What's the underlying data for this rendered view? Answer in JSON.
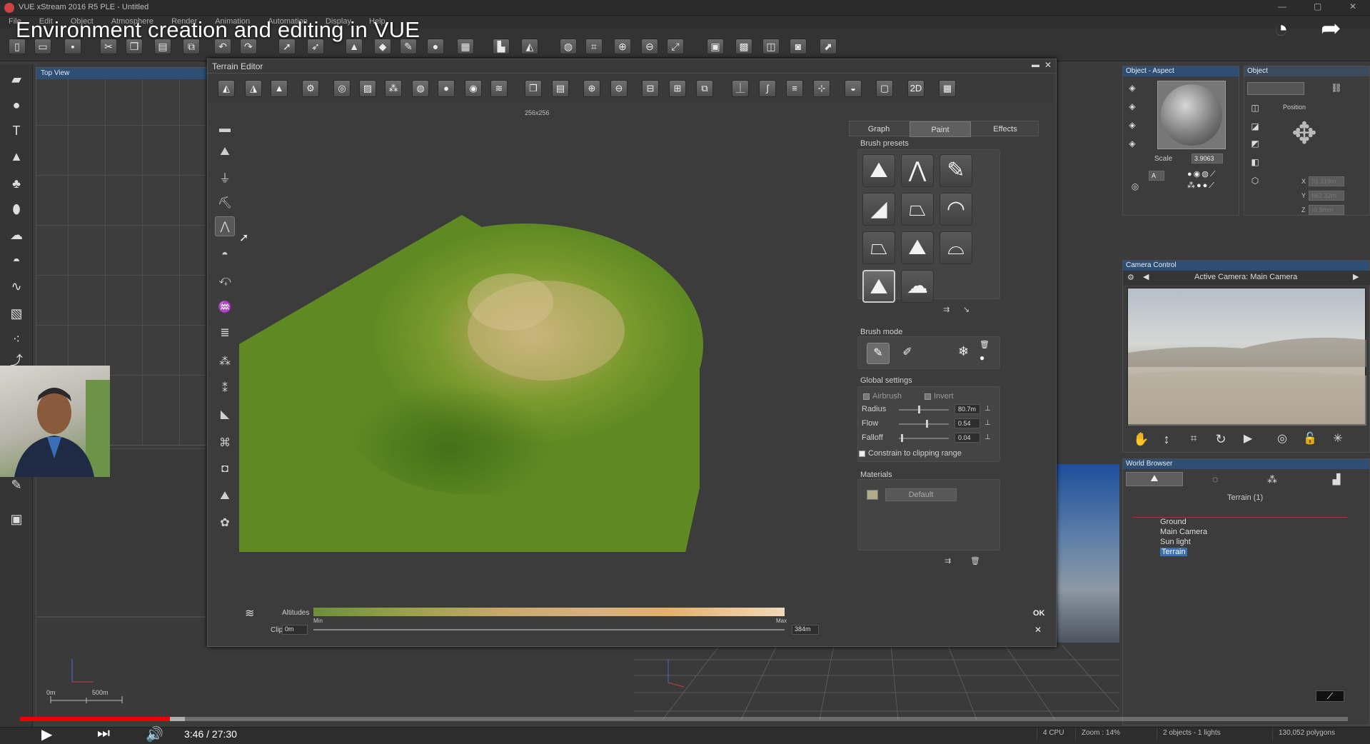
{
  "window": {
    "title": "VUE xStream 2016 R5 PLE - Untitled"
  },
  "menu": [
    "File",
    "Edit",
    "Object",
    "Atmosphere",
    "Render",
    "Animation",
    "Automation",
    "Display",
    "Help"
  ],
  "video": {
    "title": "Environment creation and editing in VUE",
    "time": "3:46 / 27:30",
    "played_fraction": 0.113,
    "loaded_fraction": 0.124
  },
  "top_view": {
    "title": "Top View"
  },
  "terrain_editor": {
    "title": "Terrain Editor",
    "resolution": "256x256",
    "tabs": [
      "Graph",
      "Paint",
      "Effects"
    ],
    "active_tab": "Paint",
    "brush_presets_label": "Brush presets",
    "brush_mode_label": "Brush mode",
    "global_settings_label": "Global settings",
    "airbrush_label": "Airbrush",
    "invert_label": "Invert",
    "radius_label": "Radius",
    "radius_value": "80.7m",
    "radius_fraction": 0.38,
    "flow_label": "Flow",
    "flow_value": "0.54",
    "flow_fraction": 0.54,
    "falloff_label": "Falloff",
    "falloff_value": "0.04",
    "falloff_fraction": 0.04,
    "constrain_label": "Constrain to clipping range",
    "materials_label": "Materials",
    "material_default": "Default",
    "altitudes_label": "Altitudes",
    "min_label": "Min",
    "max_label": "Max",
    "clip_label": "Clip",
    "clip_min": "0m",
    "clip_max": "384m",
    "ok_label": "OK",
    "colors": {
      "terrain_green": "#5f8a23",
      "terrain_light": "#b8b070"
    }
  },
  "object_aspect": {
    "title": "Object - Aspect",
    "scale_label": "Scale",
    "scale_value": "3.9063",
    "layer_label": "A"
  },
  "object": {
    "title": "Object",
    "position_label": "Position",
    "x_label": "X",
    "x_value": "31.119m",
    "y_label": "Y",
    "y_value": "663.32m",
    "z_label": "Z",
    "z_value": "-0.9mm"
  },
  "camera_control": {
    "title": "Camera Control",
    "active_camera": "Active Camera: Main Camera"
  },
  "world_browser": {
    "title": "World Browser",
    "selection_label": "Terrain (1)",
    "items": [
      "Ground",
      "Main Camera",
      "Sun light",
      "Terrain"
    ]
  },
  "scale_bar": {
    "start": "0m",
    "end": "500m"
  },
  "status": {
    "cpu": "4 CPU",
    "zoom": "Zoom : 14%",
    "objects": "2 objects - 1 lights",
    "polygons": "130,052 polygons"
  }
}
